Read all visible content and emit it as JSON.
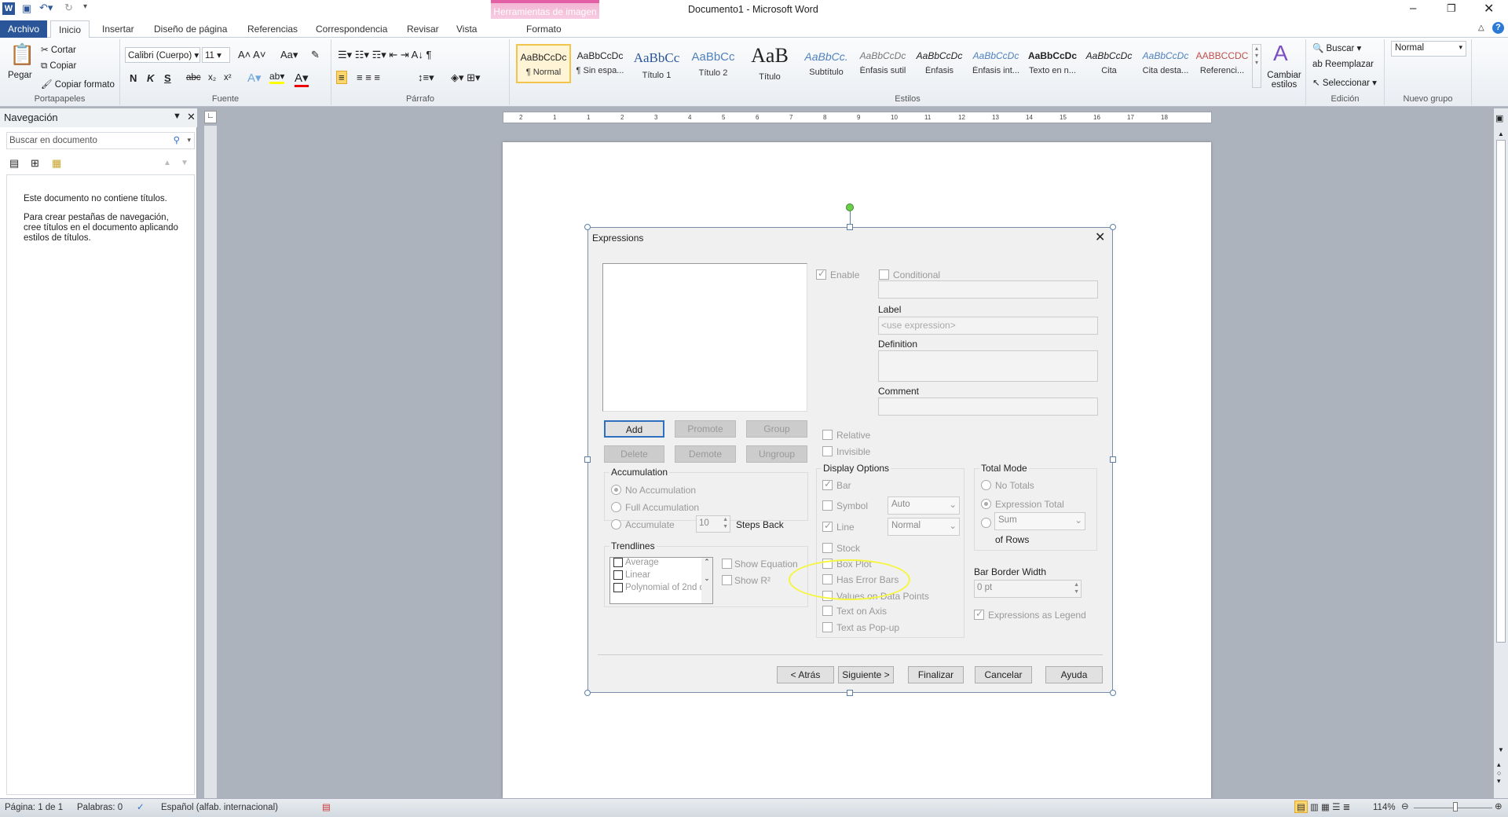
{
  "window": {
    "title": "Documento1 - Microsoft Word",
    "contextual_tab_group": "Herramientas de imagen",
    "contextual_tab": "Formato"
  },
  "tabs": [
    "Archivo",
    "Inicio",
    "Insertar",
    "Diseño de página",
    "Referencias",
    "Correspondencia",
    "Revisar",
    "Vista"
  ],
  "ribbon": {
    "clipboard": {
      "label": "Portapapeles",
      "paste": "Pegar",
      "cut": "Cortar",
      "copy": "Copiar",
      "format_painter": "Copiar formato"
    },
    "font": {
      "label": "Fuente",
      "font_name": "Calibri (Cuerpo)",
      "font_size": "11",
      "bold": "N",
      "italic": "K",
      "underline": "S"
    },
    "paragraph": {
      "label": "Párrafo"
    },
    "styles": {
      "label": "Estilos",
      "change_styles": "Cambiar estilos",
      "items": [
        {
          "preview": "AaBbCcDc",
          "name": "¶ Normal"
        },
        {
          "preview": "AaBbCcDc",
          "name": "¶ Sin espa..."
        },
        {
          "preview": "AaBbCc",
          "name": "Título 1"
        },
        {
          "preview": "AaBbCc",
          "name": "Título 2"
        },
        {
          "preview": "AaB",
          "name": "Título"
        },
        {
          "preview": "AaBbCc.",
          "name": "Subtítulo"
        },
        {
          "preview": "AaBbCcDc",
          "name": "Énfasis sutil"
        },
        {
          "preview": "AaBbCcDc",
          "name": "Énfasis"
        },
        {
          "preview": "AaBbCcDc",
          "name": "Énfasis int..."
        },
        {
          "preview": "AaBbCcDc",
          "name": "Texto en n..."
        },
        {
          "preview": "AaBbCcDc",
          "name": "Cita"
        },
        {
          "preview": "AaBbCcDc",
          "name": "Cita desta..."
        },
        {
          "preview": "AABBCCDC",
          "name": "Referenci..."
        }
      ]
    },
    "editing": {
      "label": "Edición",
      "find": "Buscar",
      "replace": "Reemplazar",
      "select": "Seleccionar"
    },
    "new_group": {
      "label": "Nuevo grupo",
      "style_select": "Normal"
    }
  },
  "navigation": {
    "title": "Navegación",
    "search_placeholder": "Buscar en documento",
    "message1": "Este documento no contiene títulos.",
    "message2": "Para crear pestañas de navegación, cree títulos en el documento aplicando estilos de títulos."
  },
  "ruler_ticks": [
    "2",
    "1",
    "1",
    "2",
    "3",
    "4",
    "5",
    "6",
    "7",
    "8",
    "9",
    "10",
    "11",
    "12",
    "13",
    "14",
    "15",
    "16",
    "17",
    "18"
  ],
  "dialog": {
    "title": "Expressions",
    "enable": "Enable",
    "conditional": "Conditional",
    "label": "Label",
    "label_placeholder": "<use expression>",
    "definition": "Definition",
    "comment": "Comment",
    "buttons": {
      "add": "Add",
      "promote": "Promote",
      "group": "Group",
      "delete": "Delete",
      "demote": "Demote",
      "ungroup": "Ungroup"
    },
    "relative": "Relative",
    "invisible": "Invisible",
    "accumulation": {
      "title": "Accumulation",
      "no": "No Accumulation",
      "full": "Full Accumulation",
      "accumulate": "Accumulate",
      "steps_value": "10",
      "steps_label": "Steps Back"
    },
    "trendlines": {
      "title": "Trendlines",
      "items": [
        "Average",
        "Linear",
        "Polynomial of 2nd d"
      ],
      "show_equation": "Show Equation",
      "show_r2": "Show R²"
    },
    "display_options": {
      "title": "Display Options",
      "bar": "Bar",
      "symbol": "Symbol",
      "symbol_value": "Auto",
      "line": "Line",
      "line_value": "Normal",
      "stock": "Stock",
      "box_plot": "Box Plot",
      "error_bars": "Has Error Bars",
      "values_on_points": "Values on Data Points",
      "text_on_axis": "Text on Axis",
      "text_popup": "Text as Pop-up"
    },
    "total_mode": {
      "title": "Total Mode",
      "no_totals": "No Totals",
      "expression_total": "Expression Total",
      "sum": "Sum",
      "of_rows": "of Rows"
    },
    "bar_border_width": {
      "label": "Bar Border Width",
      "value": "0 pt"
    },
    "expressions_as_legend": "Expressions as Legend",
    "footer": {
      "back": "< Atrás",
      "next": "Siguiente >",
      "finish": "Finalizar",
      "cancel": "Cancelar",
      "help": "Ayuda"
    },
    "highlight_color": "#f5f542"
  },
  "status": {
    "page": "Página: 1 de 1",
    "words": "Palabras: 0",
    "language": "Español (alfab. internacional)",
    "zoom": "114%"
  },
  "colors": {
    "accent": "#2b579a",
    "file_tab": "#2a5699",
    "contextual": "#e35fa5"
  }
}
